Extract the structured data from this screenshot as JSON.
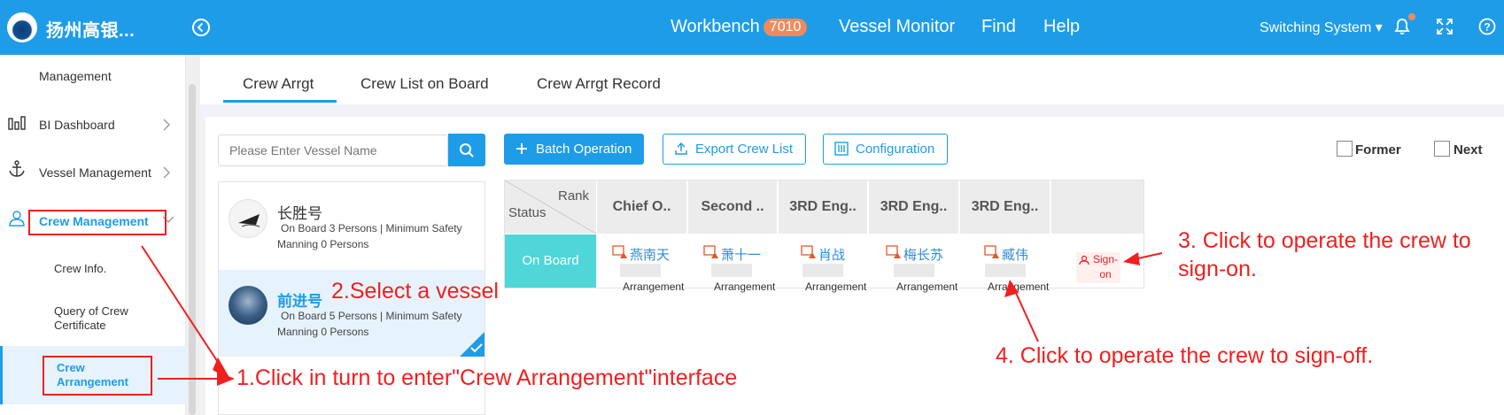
{
  "topbar": {
    "brand": "扬州高银...",
    "nav": [
      {
        "label": "Workbench",
        "badge": "7010"
      },
      {
        "label": "Vessel Monitor"
      },
      {
        "label": "Find"
      },
      {
        "label": "Help"
      }
    ],
    "switch_system": "Switching System ▾"
  },
  "sidebar": {
    "management": "Management",
    "bi_dashboard": "BI Dashboard",
    "vessel_management": "Vessel Management",
    "crew_management": "Crew Management",
    "crew_info": "Crew Info.",
    "query_cert": "Query of Crew Certificate",
    "crew_arrangement": "Crew Arrangement"
  },
  "tabs": [
    "Crew Arrgt",
    "Crew List on Board",
    "Crew Arrgt Record"
  ],
  "search": {
    "placeholder": "Please Enter Vessel Name"
  },
  "vessels": [
    {
      "name": "长胜号",
      "info": "On Board 3 Persons | Minimum Safety Manning 0 Persons"
    },
    {
      "name": "前进号",
      "info": "On Board 5 Persons | Minimum Safety Manning 0 Persons"
    }
  ],
  "toolbar": {
    "batch": "Batch Operation",
    "export": "Export Crew List",
    "config": "Configuration",
    "former": "Former",
    "next": "Next"
  },
  "grid": {
    "rank_label": "Rank",
    "status_label": "Status",
    "headers": [
      "Chief O..",
      "Second ..",
      "3RD Eng..",
      "3RD Eng..",
      "3RD Eng.."
    ],
    "status": "On Board",
    "crew": [
      "燕南天",
      "萧十一",
      "肖战",
      "梅长苏",
      "臧伟"
    ],
    "arrangement": "Arrangement",
    "sign_on": "Sign-on"
  },
  "annotations": {
    "step1": "1.Click in turn to enter\"Crew Arrangement\"interface",
    "step2": "2.Select a vessel",
    "step3": "3. Click to operate the crew to sign-on.",
    "step4": "4. Click to operate the crew to sign-off."
  },
  "colors": {
    "primary": "#1e9ce8",
    "onboard": "#4fd6d8",
    "annotation": "#f02020",
    "badge": "#f08a5d"
  }
}
